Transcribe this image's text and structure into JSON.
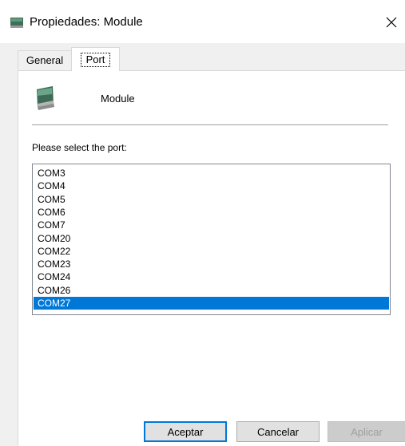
{
  "window": {
    "title": "Propiedades: Module",
    "title_icon": "device-module-icon",
    "close_icon": "close-icon"
  },
  "tabs": [
    {
      "label": "General",
      "active": false
    },
    {
      "label": "Port",
      "active": true
    }
  ],
  "device": {
    "name": "Module",
    "icon": "device-module-icon"
  },
  "port_selection": {
    "label": "Please select the port:",
    "ports": [
      "COM3",
      "COM4",
      "COM5",
      "COM6",
      "COM7",
      "COM20",
      "COM22",
      "COM23",
      "COM24",
      "COM26",
      "COM27"
    ],
    "selected": "COM27"
  },
  "buttons": {
    "ok": "Aceptar",
    "cancel": "Cancelar",
    "apply": "Aplicar"
  },
  "colors": {
    "selection": "#0078d7",
    "window_bg": "#f0f0f0",
    "panel_bg": "#ffffff"
  }
}
